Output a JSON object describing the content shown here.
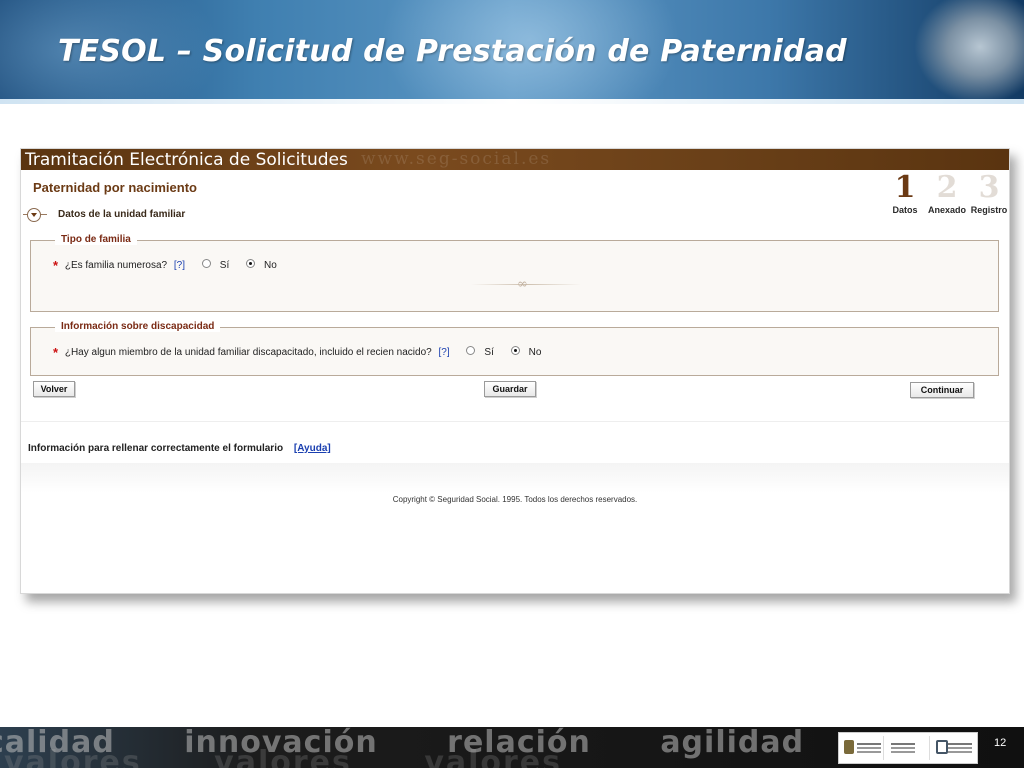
{
  "slide": {
    "title": "TESOL – Solicitud de Prestación de Paternidad",
    "page_number": "12",
    "footer_words": [
      "calidad",
      "innovación",
      "relación",
      "agilidad"
    ],
    "footer_words_lower": [
      "valores",
      "valores",
      "valores"
    ]
  },
  "app": {
    "banner_title": "Tramitación Electrónica de Solicitudes",
    "banner_watermark": "www.seg-social.es",
    "page_heading": "Paternidad por nacimiento",
    "section_heading": "Datos de la unidad familiar",
    "steps": [
      {
        "number": "1",
        "label": "Datos",
        "state": "active"
      },
      {
        "number": "2",
        "label": "Anexado",
        "state": "inactive"
      },
      {
        "number": "3",
        "label": "Registro",
        "state": "inactive"
      }
    ],
    "fieldsets": [
      {
        "legend": "Tipo de familia",
        "required_mark": "*",
        "question": "¿Es familia numerosa?",
        "help": "[?]",
        "options": [
          "Sí",
          "No"
        ],
        "selected": "No"
      },
      {
        "legend": "Información sobre discapacidad",
        "required_mark": "*",
        "question": "¿Hay algun miembro de la unidad familiar discapacitado, incluido el recien nacido?",
        "help": "[?]",
        "options": [
          "Sí",
          "No"
        ],
        "selected": "No"
      }
    ],
    "buttons": {
      "back": "Volver",
      "save": "Guardar",
      "continue": "Continuar"
    },
    "info_text": "Información para rellenar correctamente el formulario",
    "info_link": "[Ayuda]",
    "copyright": "Copyright © Seguridad Social. 1995. Todos los derechos reservados."
  },
  "colors": {
    "header_blue": "#3f7fb0",
    "banner_brown": "#7a4a1e",
    "heading_brown": "#6b3a14",
    "legend_red": "#7a2a14",
    "required_red": "#cc1111",
    "link_blue": "#1a3fb0"
  },
  "icons": [
    "section-collapse-icon",
    "radio-unchecked-icon",
    "radio-checked-icon",
    "spain-crest-icon",
    "seguridad-social-icon"
  ]
}
